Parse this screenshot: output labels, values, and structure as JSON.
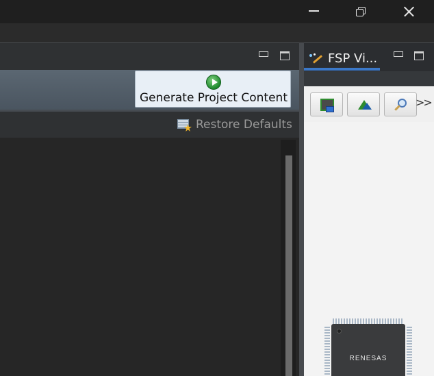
{
  "window": {
    "controls": {
      "minimize_icon": "minimize-icon",
      "restore_icon": "restore-icon",
      "close_icon": "close-icon"
    }
  },
  "editor": {
    "generate_button": {
      "label": "Generate Project Content",
      "icon": "play-icon"
    },
    "restore_defaults": {
      "label": "Restore Defaults",
      "icon": "restore-defaults-icon"
    }
  },
  "fsp_view": {
    "tab_label": "FSP Vi...",
    "tab_icon": "magic-wand-icon",
    "toolbar_buttons": [
      {
        "icon": "chip-save-icon"
      },
      {
        "icon": "mountain-icon"
      },
      {
        "icon": "zoom-icon"
      }
    ],
    "overflow": ">>",
    "chip_brand": "RENESAS"
  },
  "colors": {
    "accent": "#3b78c8",
    "generate_button_bg": "#e8eff6",
    "play_green": "#1f8a2e"
  }
}
